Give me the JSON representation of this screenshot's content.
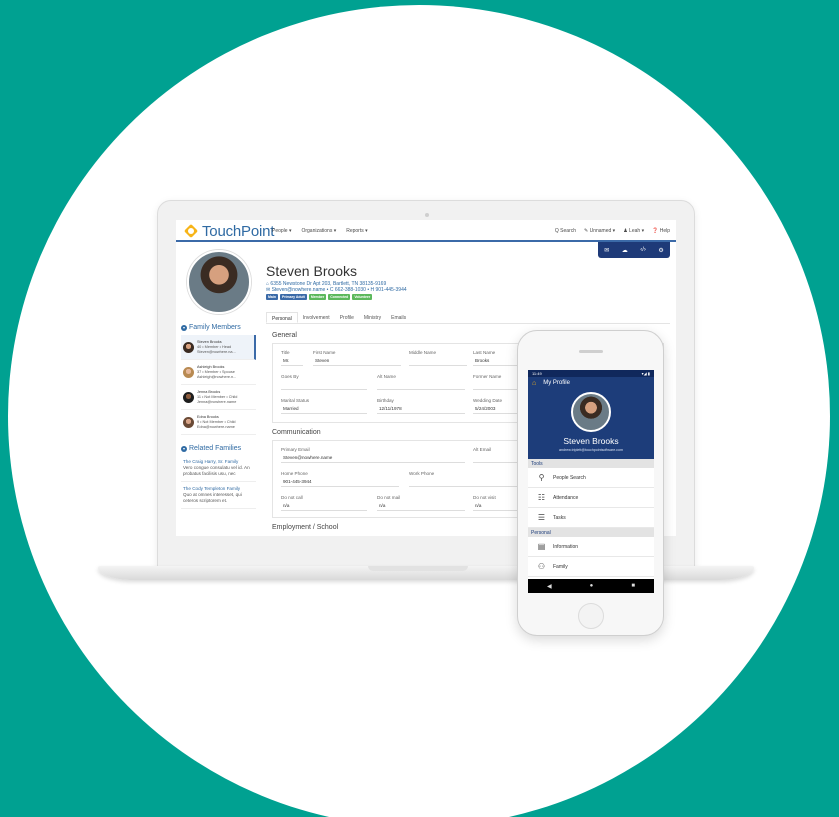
{
  "app": {
    "logo_text": "TouchPoint"
  },
  "nav": {
    "left": [
      "People ▾",
      "Organizations ▾",
      "Reports ▾"
    ],
    "right": [
      "Q Search",
      "✎ Unnamed ▾",
      "♟ Leah ▾",
      "❓ Help"
    ]
  },
  "toolbar": {
    "icons": [
      "envelope-icon",
      "cloud-upload-icon",
      "code-icon",
      "gear-icon"
    ]
  },
  "profile": {
    "name": "Steven Brooks",
    "address": "⌂ 6355 Newstone Dr Apt 203, Bartlett, TN 38135-9169",
    "contact": "✉ Steven@nowhere.name • C 662-388-1030 • H 901-445-3944",
    "badges": [
      {
        "label": "Main",
        "color": "#3b6aa8"
      },
      {
        "label": "Primary Adult",
        "color": "#3b6aa8"
      },
      {
        "label": "Member",
        "color": "#5cb85c"
      },
      {
        "label": "Connected",
        "color": "#5cb85c"
      },
      {
        "label": "Volunteer",
        "color": "#5cb85c"
      }
    ]
  },
  "tabs": [
    "Personal",
    "Involvement",
    "Profile",
    "Ministry",
    "Emails"
  ],
  "family": {
    "title": "Family Members",
    "members": [
      {
        "name": "Steven Brooks",
        "line2": "40 • Member • Head",
        "line3": "Steven@nowhere.na..."
      },
      {
        "name": "Ashleigh Brooks",
        "line2": "37 • Member • Spouse",
        "line3": "Ashleigh@nowhere.n..."
      },
      {
        "name": "Jenna Brooks",
        "line2": "11 • Not Member • Child",
        "line3": "Jenna@nowhere.name"
      },
      {
        "name": "Edna Brooks",
        "line2": "9 • Not Member • Child",
        "line3": "Edna@nowhere.name"
      }
    ]
  },
  "related": {
    "title": "Related Families",
    "items": [
      {
        "name": "The Craig Harry, Sr. Family",
        "desc": "Vero congue consulatu vel id. An probatus facilisis usu, nec"
      },
      {
        "name": "The Cody Templeton Family",
        "desc": "Quo at omnes interesset, qui ceteros scriptorem et."
      }
    ]
  },
  "general": {
    "title": "General",
    "fields": {
      "title": {
        "label": "Title",
        "value": "Mr."
      },
      "first_name": {
        "label": "First Name",
        "value": "Steven"
      },
      "middle_name": {
        "label": "Middle Name",
        "value": ""
      },
      "last_name": {
        "label": "Last Name",
        "value": "Brooks"
      },
      "goes_by": {
        "label": "Goes By",
        "value": ""
      },
      "alt_name": {
        "label": "Alt Name",
        "value": ""
      },
      "former_name": {
        "label": "Former Name",
        "value": ""
      },
      "marital_status": {
        "label": "Marital Status",
        "value": "Married"
      },
      "birthday": {
        "label": "Birthday",
        "value": "12/11/1978"
      },
      "wedding_date": {
        "label": "Wedding Date",
        "value": "5/24/2003"
      }
    }
  },
  "communication": {
    "title": "Communication",
    "fields": {
      "primary_email": {
        "label": "Primary Email",
        "value": "Steven@nowhere.name"
      },
      "alt_email": {
        "label": "Alt Email",
        "value": ""
      },
      "home_phone": {
        "label": "Home Phone",
        "value": "901-445-3944"
      },
      "work_phone": {
        "label": "Work Phone",
        "value": ""
      },
      "do_not_call": {
        "label": "Do not call",
        "value": "n/a"
      },
      "do_not_mail": {
        "label": "Do not mail",
        "value": "n/a"
      },
      "do_not_visit": {
        "label": "Do not visit",
        "value": "n/a"
      }
    }
  },
  "employment": {
    "title": "Employment / School"
  },
  "phone": {
    "status_time": "11:49",
    "status_icons": "▾◢ ▮",
    "app_title": "My Profile",
    "name": "Steven Brooks",
    "email": "andrew.triplett@touchpointsoftware.com",
    "sections": {
      "tools": "Tools",
      "personal": "Personal"
    },
    "tools": [
      {
        "label": "People Search",
        "icon": "people-search-icon",
        "glyph": "⚲"
      },
      {
        "label": "Attendance",
        "icon": "attendance-icon",
        "glyph": "☷"
      },
      {
        "label": "Tasks",
        "icon": "tasks-icon",
        "glyph": "☰"
      }
    ],
    "personal": [
      {
        "label": "Information",
        "icon": "information-icon",
        "glyph": "▤"
      },
      {
        "label": "Family",
        "icon": "family-icon",
        "glyph": "⚇"
      }
    ],
    "nav": [
      "◀",
      "●",
      "■"
    ]
  }
}
